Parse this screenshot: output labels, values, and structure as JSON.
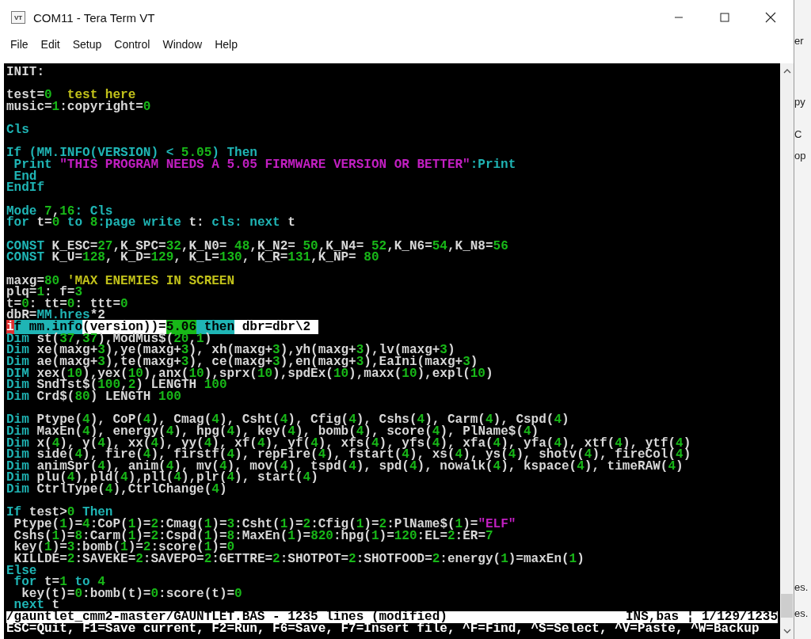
{
  "window": {
    "icon_label": "VT",
    "title": "COM11 - Tera Term VT"
  },
  "menu": [
    "File",
    "Edit",
    "Setup",
    "Control",
    "Window",
    "Help"
  ],
  "terminal": {
    "lines": [
      {
        "kind": "code",
        "selected": false,
        "segments": [
          {
            "kind": "txt",
            "text": "INIT:"
          }
        ]
      },
      {
        "kind": "blank"
      },
      {
        "kind": "code",
        "selected": false,
        "segments": [
          {
            "kind": "txt",
            "text": "test="
          },
          {
            "kind": "num",
            "text": "0"
          },
          {
            "kind": "rem",
            "text": "  test here"
          }
        ]
      },
      {
        "kind": "code",
        "selected": false,
        "segments": [
          {
            "kind": "txt",
            "text": "music="
          },
          {
            "kind": "num",
            "text": "1"
          },
          {
            "kind": "txt",
            "text": ":copyright="
          },
          {
            "kind": "num",
            "text": "0"
          }
        ]
      },
      {
        "kind": "blank"
      },
      {
        "kind": "code",
        "selected": false,
        "segments": [
          {
            "kind": "kw",
            "text": "Cls"
          }
        ]
      },
      {
        "kind": "blank"
      },
      {
        "kind": "code",
        "selected": false,
        "segments": [
          {
            "kind": "kw",
            "text": "If (MM.INFO(VERSION) < "
          },
          {
            "kind": "num",
            "text": "5.05"
          },
          {
            "kind": "kw",
            "text": ") Then"
          }
        ]
      },
      {
        "kind": "code",
        "selected": false,
        "segments": [
          {
            "kind": "kw",
            "text": " Print "
          },
          {
            "kind": "str",
            "text": "\"THIS PROGRAM NEEDS A 5.05 FIRMWARE VERSION OR BETTER\""
          },
          {
            "kind": "kw",
            "text": ":Print"
          }
        ]
      },
      {
        "kind": "code",
        "selected": false,
        "segments": [
          {
            "kind": "kw",
            "text": " End"
          }
        ]
      },
      {
        "kind": "code",
        "selected": false,
        "segments": [
          {
            "kind": "kw",
            "text": "EndIf"
          }
        ]
      },
      {
        "kind": "blank"
      },
      {
        "kind": "code",
        "selected": false,
        "segments": [
          {
            "kind": "kw",
            "text": "Mode "
          },
          {
            "kind": "num",
            "text": "7"
          },
          {
            "kind": "txt",
            "text": ","
          },
          {
            "kind": "num",
            "text": "16"
          },
          {
            "kind": "kw",
            "text": ": Cls"
          }
        ]
      },
      {
        "kind": "code",
        "selected": false,
        "segments": [
          {
            "kind": "kw",
            "text": "for"
          },
          {
            "kind": "txt",
            "text": " t="
          },
          {
            "kind": "num",
            "text": "0"
          },
          {
            "kind": "kw",
            "text": " to "
          },
          {
            "kind": "num",
            "text": "8"
          },
          {
            "kind": "kw",
            "text": ":page write"
          },
          {
            "kind": "txt",
            "text": " t: "
          },
          {
            "kind": "kw",
            "text": "cls: next"
          },
          {
            "kind": "txt",
            "text": " t"
          }
        ]
      },
      {
        "kind": "blank"
      },
      {
        "kind": "code",
        "selected": false,
        "segments": [
          {
            "kind": "kw",
            "text": "CONST"
          },
          {
            "kind": "txt",
            "text": " K_ESC="
          },
          {
            "kind": "num",
            "text": "27"
          },
          {
            "kind": "txt",
            "text": ",K_SPC="
          },
          {
            "kind": "num",
            "text": "32"
          },
          {
            "kind": "txt",
            "text": ",K_N0= "
          },
          {
            "kind": "num",
            "text": "48"
          },
          {
            "kind": "txt",
            "text": ",K_N2= "
          },
          {
            "kind": "num",
            "text": "50"
          },
          {
            "kind": "txt",
            "text": ",K_N4= "
          },
          {
            "kind": "num",
            "text": "52"
          },
          {
            "kind": "txt",
            "text": ",K_N6="
          },
          {
            "kind": "num",
            "text": "54"
          },
          {
            "kind": "txt",
            "text": ",K_N8="
          },
          {
            "kind": "num",
            "text": "56"
          }
        ]
      },
      {
        "kind": "code",
        "selected": false,
        "segments": [
          {
            "kind": "kw",
            "text": "CONST"
          },
          {
            "kind": "txt",
            "text": " K_U="
          },
          {
            "kind": "num",
            "text": "128"
          },
          {
            "kind": "txt",
            "text": ", K_D="
          },
          {
            "kind": "num",
            "text": "129"
          },
          {
            "kind": "txt",
            "text": ", K_L="
          },
          {
            "kind": "num",
            "text": "130"
          },
          {
            "kind": "txt",
            "text": ", K_R="
          },
          {
            "kind": "num",
            "text": "131"
          },
          {
            "kind": "txt",
            "text": ",K_NP= "
          },
          {
            "kind": "num",
            "text": "80"
          }
        ]
      },
      {
        "kind": "blank"
      },
      {
        "kind": "code",
        "selected": false,
        "segments": [
          {
            "kind": "txt",
            "text": "maxg="
          },
          {
            "kind": "num",
            "text": "80"
          },
          {
            "kind": "rem",
            "text": " 'MAX ENEMIES IN SCREEN"
          }
        ]
      },
      {
        "kind": "code",
        "selected": false,
        "segments": [
          {
            "kind": "txt",
            "text": "plq="
          },
          {
            "kind": "num",
            "text": "1"
          },
          {
            "kind": "txt",
            "text": ": f="
          },
          {
            "kind": "num",
            "text": "3"
          }
        ]
      },
      {
        "kind": "code",
        "selected": false,
        "segments": [
          {
            "kind": "txt",
            "text": "t="
          },
          {
            "kind": "num",
            "text": "0"
          },
          {
            "kind": "txt",
            "text": ": tt="
          },
          {
            "kind": "num",
            "text": "0"
          },
          {
            "kind": "txt",
            "text": ": ttt="
          },
          {
            "kind": "num",
            "text": "0"
          }
        ]
      },
      {
        "kind": "code",
        "selected": false,
        "segments": [
          {
            "kind": "txt",
            "text": "dbR="
          },
          {
            "kind": "kw",
            "text": "MM.hres"
          },
          {
            "kind": "txt",
            "text": "*2"
          }
        ]
      },
      {
        "kind": "code",
        "selected": true,
        "segments": [
          {
            "kind": "cursor",
            "text": "i"
          },
          {
            "kind": "kw",
            "text": "f mm.info"
          },
          {
            "kind": "txt",
            "text": "(version))="
          },
          {
            "kind": "num",
            "text": "5.06"
          },
          {
            "kind": "kw",
            "text": " then"
          },
          {
            "kind": "txt",
            "text": " dbr=dbr\\2 "
          }
        ]
      },
      {
        "kind": "code",
        "selected": false,
        "segments": [
          {
            "kind": "kw",
            "text": "Dim"
          },
          {
            "kind": "txt",
            "text": " st("
          },
          {
            "kind": "num",
            "text": "37"
          },
          {
            "kind": "txt",
            "text": ","
          },
          {
            "kind": "num",
            "text": "37"
          },
          {
            "kind": "txt",
            "text": "),ModMus$("
          },
          {
            "kind": "num",
            "text": "20"
          },
          {
            "kind": "txt",
            "text": ","
          },
          {
            "kind": "num",
            "text": "1"
          },
          {
            "kind": "txt",
            "text": ")"
          }
        ]
      },
      {
        "kind": "code",
        "selected": false,
        "segments": [
          {
            "kind": "kw",
            "text": "Dim"
          },
          {
            "kind": "txt",
            "text": " xe(maxg+"
          },
          {
            "kind": "num",
            "text": "3"
          },
          {
            "kind": "txt",
            "text": "),ye(maxg+"
          },
          {
            "kind": "num",
            "text": "3"
          },
          {
            "kind": "txt",
            "text": "), xh(maxg+"
          },
          {
            "kind": "num",
            "text": "3"
          },
          {
            "kind": "txt",
            "text": "),yh(maxg+"
          },
          {
            "kind": "num",
            "text": "3"
          },
          {
            "kind": "txt",
            "text": "),lv(maxg+"
          },
          {
            "kind": "num",
            "text": "3"
          },
          {
            "kind": "txt",
            "text": ")"
          }
        ]
      },
      {
        "kind": "code",
        "selected": false,
        "segments": [
          {
            "kind": "kw",
            "text": "Dim"
          },
          {
            "kind": "txt",
            "text": " ae(maxg+"
          },
          {
            "kind": "num",
            "text": "3"
          },
          {
            "kind": "txt",
            "text": "),te(maxg+"
          },
          {
            "kind": "num",
            "text": "3"
          },
          {
            "kind": "txt",
            "text": "), ce(maxg+"
          },
          {
            "kind": "num",
            "text": "3"
          },
          {
            "kind": "txt",
            "text": "),en(maxg+"
          },
          {
            "kind": "num",
            "text": "3"
          },
          {
            "kind": "txt",
            "text": "),EaIni(maxg+"
          },
          {
            "kind": "num",
            "text": "3"
          },
          {
            "kind": "txt",
            "text": ")"
          }
        ]
      },
      {
        "kind": "code",
        "selected": false,
        "segments": [
          {
            "kind": "kw",
            "text": "DIM"
          },
          {
            "kind": "txt",
            "text": " xex("
          },
          {
            "kind": "num",
            "text": "10"
          },
          {
            "kind": "txt",
            "text": "),yex("
          },
          {
            "kind": "num",
            "text": "10"
          },
          {
            "kind": "txt",
            "text": "),anx("
          },
          {
            "kind": "num",
            "text": "10"
          },
          {
            "kind": "txt",
            "text": "),sprx("
          },
          {
            "kind": "num",
            "text": "10"
          },
          {
            "kind": "txt",
            "text": "),spdEx("
          },
          {
            "kind": "num",
            "text": "10"
          },
          {
            "kind": "txt",
            "text": "),maxx("
          },
          {
            "kind": "num",
            "text": "10"
          },
          {
            "kind": "txt",
            "text": "),expl("
          },
          {
            "kind": "num",
            "text": "10"
          },
          {
            "kind": "txt",
            "text": ")"
          }
        ]
      },
      {
        "kind": "code",
        "selected": false,
        "segments": [
          {
            "kind": "kw",
            "text": "Dim"
          },
          {
            "kind": "txt",
            "text": " SndTst$("
          },
          {
            "kind": "num",
            "text": "100"
          },
          {
            "kind": "txt",
            "text": ","
          },
          {
            "kind": "num",
            "text": "2"
          },
          {
            "kind": "txt",
            "text": ") LENGTH "
          },
          {
            "kind": "num",
            "text": "100"
          }
        ]
      },
      {
        "kind": "code",
        "selected": false,
        "segments": [
          {
            "kind": "kw",
            "text": "Dim"
          },
          {
            "kind": "txt",
            "text": " Crd$("
          },
          {
            "kind": "num",
            "text": "80"
          },
          {
            "kind": "txt",
            "text": ") LENGTH "
          },
          {
            "kind": "num",
            "text": "100"
          }
        ]
      },
      {
        "kind": "blank"
      },
      {
        "kind": "code",
        "selected": false,
        "segments": [
          {
            "kind": "kw",
            "text": "Dim"
          },
          {
            "kind": "txt",
            "text": " Ptype("
          },
          {
            "kind": "num",
            "text": "4"
          },
          {
            "kind": "txt",
            "text": "), CoP("
          },
          {
            "kind": "num",
            "text": "4"
          },
          {
            "kind": "txt",
            "text": "), Cmag("
          },
          {
            "kind": "num",
            "text": "4"
          },
          {
            "kind": "txt",
            "text": "), Csht("
          },
          {
            "kind": "num",
            "text": "4"
          },
          {
            "kind": "txt",
            "text": "), Cfig("
          },
          {
            "kind": "num",
            "text": "4"
          },
          {
            "kind": "txt",
            "text": "), Cshs("
          },
          {
            "kind": "num",
            "text": "4"
          },
          {
            "kind": "txt",
            "text": "), Carm("
          },
          {
            "kind": "num",
            "text": "4"
          },
          {
            "kind": "txt",
            "text": "), Cspd("
          },
          {
            "kind": "num",
            "text": "4"
          },
          {
            "kind": "txt",
            "text": ")"
          }
        ]
      },
      {
        "kind": "code",
        "selected": false,
        "segments": [
          {
            "kind": "kw",
            "text": "Dim"
          },
          {
            "kind": "txt",
            "text": " MaxEn("
          },
          {
            "kind": "num",
            "text": "4"
          },
          {
            "kind": "txt",
            "text": "), energy("
          },
          {
            "kind": "num",
            "text": "4"
          },
          {
            "kind": "txt",
            "text": "), hpg("
          },
          {
            "kind": "num",
            "text": "4"
          },
          {
            "kind": "txt",
            "text": "), key("
          },
          {
            "kind": "num",
            "text": "4"
          },
          {
            "kind": "txt",
            "text": "), bomb("
          },
          {
            "kind": "num",
            "text": "4"
          },
          {
            "kind": "txt",
            "text": "), score("
          },
          {
            "kind": "num",
            "text": "4"
          },
          {
            "kind": "txt",
            "text": "), PlName$("
          },
          {
            "kind": "num",
            "text": "4"
          },
          {
            "kind": "txt",
            "text": ")"
          }
        ]
      },
      {
        "kind": "code",
        "selected": false,
        "segments": [
          {
            "kind": "kw",
            "text": "Dim"
          },
          {
            "kind": "txt",
            "text": " x("
          },
          {
            "kind": "num",
            "text": "4"
          },
          {
            "kind": "txt",
            "text": "), y("
          },
          {
            "kind": "num",
            "text": "4"
          },
          {
            "kind": "txt",
            "text": "), xx("
          },
          {
            "kind": "num",
            "text": "4"
          },
          {
            "kind": "txt",
            "text": "), yy("
          },
          {
            "kind": "num",
            "text": "4"
          },
          {
            "kind": "txt",
            "text": "), xf("
          },
          {
            "kind": "num",
            "text": "4"
          },
          {
            "kind": "txt",
            "text": "), yf("
          },
          {
            "kind": "num",
            "text": "4"
          },
          {
            "kind": "txt",
            "text": "), xfs("
          },
          {
            "kind": "num",
            "text": "4"
          },
          {
            "kind": "txt",
            "text": "), yfs("
          },
          {
            "kind": "num",
            "text": "4"
          },
          {
            "kind": "txt",
            "text": "), xfa("
          },
          {
            "kind": "num",
            "text": "4"
          },
          {
            "kind": "txt",
            "text": "), yfa("
          },
          {
            "kind": "num",
            "text": "4"
          },
          {
            "kind": "txt",
            "text": "), xtf("
          },
          {
            "kind": "num",
            "text": "4"
          },
          {
            "kind": "txt",
            "text": "), ytf("
          },
          {
            "kind": "num",
            "text": "4"
          },
          {
            "kind": "txt",
            "text": ")"
          }
        ]
      },
      {
        "kind": "code",
        "selected": false,
        "segments": [
          {
            "kind": "kw",
            "text": "Dim"
          },
          {
            "kind": "txt",
            "text": " side("
          },
          {
            "kind": "num",
            "text": "4"
          },
          {
            "kind": "txt",
            "text": "), fire("
          },
          {
            "kind": "num",
            "text": "4"
          },
          {
            "kind": "txt",
            "text": "), firstf("
          },
          {
            "kind": "num",
            "text": "4"
          },
          {
            "kind": "txt",
            "text": "), repFire("
          },
          {
            "kind": "num",
            "text": "4"
          },
          {
            "kind": "txt",
            "text": "), fstart("
          },
          {
            "kind": "num",
            "text": "4"
          },
          {
            "kind": "txt",
            "text": "), xs("
          },
          {
            "kind": "num",
            "text": "4"
          },
          {
            "kind": "txt",
            "text": "), ys("
          },
          {
            "kind": "num",
            "text": "4"
          },
          {
            "kind": "txt",
            "text": "), shotv("
          },
          {
            "kind": "num",
            "text": "4"
          },
          {
            "kind": "txt",
            "text": "), fireCol("
          },
          {
            "kind": "num",
            "text": "4"
          },
          {
            "kind": "txt",
            "text": ")"
          }
        ]
      },
      {
        "kind": "code",
        "selected": false,
        "segments": [
          {
            "kind": "kw",
            "text": "Dim"
          },
          {
            "kind": "txt",
            "text": " animSpr("
          },
          {
            "kind": "num",
            "text": "4"
          },
          {
            "kind": "txt",
            "text": "), anim("
          },
          {
            "kind": "num",
            "text": "4"
          },
          {
            "kind": "txt",
            "text": "), mv("
          },
          {
            "kind": "num",
            "text": "4"
          },
          {
            "kind": "txt",
            "text": "), mov("
          },
          {
            "kind": "num",
            "text": "4"
          },
          {
            "kind": "txt",
            "text": "), tspd("
          },
          {
            "kind": "num",
            "text": "4"
          },
          {
            "kind": "txt",
            "text": "), spd("
          },
          {
            "kind": "num",
            "text": "4"
          },
          {
            "kind": "txt",
            "text": "), nowalk("
          },
          {
            "kind": "num",
            "text": "4"
          },
          {
            "kind": "txt",
            "text": "), kspace("
          },
          {
            "kind": "num",
            "text": "4"
          },
          {
            "kind": "txt",
            "text": "), timeRAW("
          },
          {
            "kind": "num",
            "text": "4"
          },
          {
            "kind": "txt",
            "text": ")"
          }
        ]
      },
      {
        "kind": "code",
        "selected": false,
        "segments": [
          {
            "kind": "kw",
            "text": "Dim"
          },
          {
            "kind": "txt",
            "text": " plu("
          },
          {
            "kind": "num",
            "text": "4"
          },
          {
            "kind": "txt",
            "text": "),pld("
          },
          {
            "kind": "num",
            "text": "4"
          },
          {
            "kind": "txt",
            "text": "),pll("
          },
          {
            "kind": "num",
            "text": "4"
          },
          {
            "kind": "txt",
            "text": "),plr("
          },
          {
            "kind": "num",
            "text": "4"
          },
          {
            "kind": "txt",
            "text": "), start("
          },
          {
            "kind": "num",
            "text": "4"
          },
          {
            "kind": "txt",
            "text": ")"
          }
        ]
      },
      {
        "kind": "code",
        "selected": false,
        "segments": [
          {
            "kind": "kw",
            "text": "Dim"
          },
          {
            "kind": "txt",
            "text": " CtrlType("
          },
          {
            "kind": "num",
            "text": "4"
          },
          {
            "kind": "txt",
            "text": "),CtrlChange("
          },
          {
            "kind": "num",
            "text": "4"
          },
          {
            "kind": "txt",
            "text": ")"
          }
        ]
      },
      {
        "kind": "blank"
      },
      {
        "kind": "code",
        "selected": false,
        "segments": [
          {
            "kind": "kw",
            "text": "If"
          },
          {
            "kind": "txt",
            "text": " test>"
          },
          {
            "kind": "num",
            "text": "0"
          },
          {
            "kind": "kw",
            "text": " Then"
          }
        ]
      },
      {
        "kind": "code",
        "selected": false,
        "segments": [
          {
            "kind": "txt",
            "text": " Ptype("
          },
          {
            "kind": "num",
            "text": "1"
          },
          {
            "kind": "txt",
            "text": ")="
          },
          {
            "kind": "num",
            "text": "4"
          },
          {
            "kind": "txt",
            "text": ":CoP("
          },
          {
            "kind": "num",
            "text": "1"
          },
          {
            "kind": "txt",
            "text": ")="
          },
          {
            "kind": "num",
            "text": "2"
          },
          {
            "kind": "txt",
            "text": ":Cmag("
          },
          {
            "kind": "num",
            "text": "1"
          },
          {
            "kind": "txt",
            "text": ")="
          },
          {
            "kind": "num",
            "text": "3"
          },
          {
            "kind": "txt",
            "text": ":Csht("
          },
          {
            "kind": "num",
            "text": "1"
          },
          {
            "kind": "txt",
            "text": ")="
          },
          {
            "kind": "num",
            "text": "2"
          },
          {
            "kind": "txt",
            "text": ":Cfig("
          },
          {
            "kind": "num",
            "text": "1"
          },
          {
            "kind": "txt",
            "text": ")="
          },
          {
            "kind": "num",
            "text": "2"
          },
          {
            "kind": "txt",
            "text": ":PlName$("
          },
          {
            "kind": "num",
            "text": "1"
          },
          {
            "kind": "txt",
            "text": ")="
          },
          {
            "kind": "str",
            "text": "\"ELF\""
          }
        ]
      },
      {
        "kind": "code",
        "selected": false,
        "segments": [
          {
            "kind": "txt",
            "text": " Cshs("
          },
          {
            "kind": "num",
            "text": "1"
          },
          {
            "kind": "txt",
            "text": ")="
          },
          {
            "kind": "num",
            "text": "8"
          },
          {
            "kind": "txt",
            "text": ":Carm("
          },
          {
            "kind": "num",
            "text": "1"
          },
          {
            "kind": "txt",
            "text": ")="
          },
          {
            "kind": "num",
            "text": "2"
          },
          {
            "kind": "txt",
            "text": ":Cspd("
          },
          {
            "kind": "num",
            "text": "1"
          },
          {
            "kind": "txt",
            "text": ")="
          },
          {
            "kind": "num",
            "text": "8"
          },
          {
            "kind": "txt",
            "text": ":MaxEn("
          },
          {
            "kind": "num",
            "text": "1"
          },
          {
            "kind": "txt",
            "text": ")="
          },
          {
            "kind": "num",
            "text": "820"
          },
          {
            "kind": "txt",
            "text": ":hpg("
          },
          {
            "kind": "num",
            "text": "1"
          },
          {
            "kind": "txt",
            "text": ")="
          },
          {
            "kind": "num",
            "text": "120"
          },
          {
            "kind": "txt",
            "text": ":EL="
          },
          {
            "kind": "num",
            "text": "2"
          },
          {
            "kind": "txt",
            "text": ":ER="
          },
          {
            "kind": "num",
            "text": "7"
          }
        ]
      },
      {
        "kind": "code",
        "selected": false,
        "segments": [
          {
            "kind": "txt",
            "text": " key("
          },
          {
            "kind": "num",
            "text": "1"
          },
          {
            "kind": "txt",
            "text": ")="
          },
          {
            "kind": "num",
            "text": "3"
          },
          {
            "kind": "txt",
            "text": ":bomb("
          },
          {
            "kind": "num",
            "text": "1"
          },
          {
            "kind": "txt",
            "text": ")="
          },
          {
            "kind": "num",
            "text": "2"
          },
          {
            "kind": "txt",
            "text": ":score("
          },
          {
            "kind": "num",
            "text": "1"
          },
          {
            "kind": "txt",
            "text": ")="
          },
          {
            "kind": "num",
            "text": "0"
          }
        ]
      },
      {
        "kind": "code",
        "selected": false,
        "segments": [
          {
            "kind": "txt",
            "text": " KILLDE="
          },
          {
            "kind": "num",
            "text": "2"
          },
          {
            "kind": "txt",
            "text": ":SAVEKE="
          },
          {
            "kind": "num",
            "text": "2"
          },
          {
            "kind": "txt",
            "text": ":SAVEPO="
          },
          {
            "kind": "num",
            "text": "2"
          },
          {
            "kind": "txt",
            "text": ":GETTRE="
          },
          {
            "kind": "num",
            "text": "2"
          },
          {
            "kind": "txt",
            "text": ":SHOTPOT="
          },
          {
            "kind": "num",
            "text": "2"
          },
          {
            "kind": "txt",
            "text": ":SHOTFOOD="
          },
          {
            "kind": "num",
            "text": "2"
          },
          {
            "kind": "txt",
            "text": ":energy("
          },
          {
            "kind": "num",
            "text": "1"
          },
          {
            "kind": "txt",
            "text": ")=maxEn("
          },
          {
            "kind": "num",
            "text": "1"
          },
          {
            "kind": "txt",
            "text": ")"
          }
        ]
      },
      {
        "kind": "code",
        "selected": false,
        "segments": [
          {
            "kind": "kw",
            "text": "Else"
          }
        ]
      },
      {
        "kind": "code",
        "selected": false,
        "segments": [
          {
            "kind": "kw",
            "text": " for"
          },
          {
            "kind": "txt",
            "text": " t="
          },
          {
            "kind": "num",
            "text": "1"
          },
          {
            "kind": "kw",
            "text": " to "
          },
          {
            "kind": "num",
            "text": "4"
          }
        ]
      },
      {
        "kind": "code",
        "selected": false,
        "segments": [
          {
            "kind": "txt",
            "text": "  key(t)="
          },
          {
            "kind": "num",
            "text": "0"
          },
          {
            "kind": "txt",
            "text": ":bomb(t)="
          },
          {
            "kind": "num",
            "text": "0"
          },
          {
            "kind": "txt",
            "text": ":score(t)="
          },
          {
            "kind": "num",
            "text": "0"
          }
        ]
      },
      {
        "kind": "code",
        "selected": false,
        "segments": [
          {
            "kind": "kw",
            "text": " next"
          },
          {
            "kind": "txt",
            "text": " t"
          }
        ]
      }
    ],
    "status_line": {
      "file": "/gauntlet_cmm2-master/GAUNTLET.BAS - 1235 lines (modified)",
      "position": "INS,bas ¦ 1/129/1235"
    },
    "key_help": "ESC=Quit, F1=Save current, F2=Run, F6=Save, F7=Insert file, ^F=Find, ^S=Select, ^V=Paste, ^W=Backup"
  },
  "background_window": [
    "er",
    "py",
    "C",
    "op",
    "es.",
    "es."
  ]
}
